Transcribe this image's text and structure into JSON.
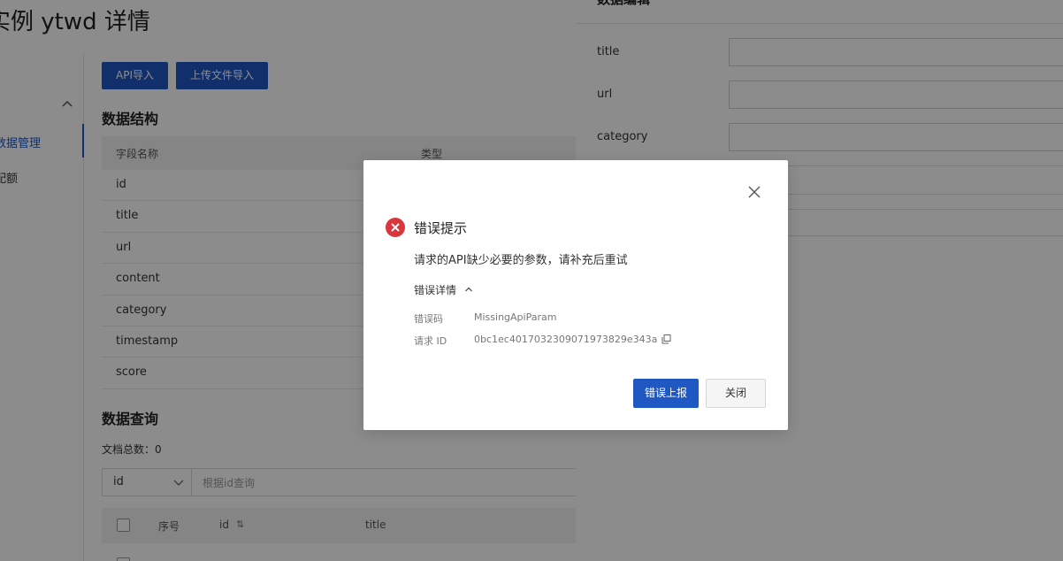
{
  "page": {
    "title": "实例 ytwd 详情",
    "sidebar": {
      "active_item": "数据管理",
      "item2": "配额"
    },
    "actions": {
      "api_import": "API导入",
      "upload_import": "上传文件导入"
    },
    "structure": {
      "title": "数据结构",
      "columns": [
        "字段名称",
        "类型"
      ],
      "fields": [
        "id",
        "title",
        "url",
        "content",
        "category",
        "timestamp",
        "score"
      ]
    },
    "query": {
      "title": "数据查询",
      "doc_count_label": "文档总数：0",
      "select_value": "id",
      "input_placeholder": "根据id查询",
      "table": {
        "col_seq": "序号",
        "col_id": "id",
        "col_id_sort": "⇅",
        "col_title": "title"
      }
    }
  },
  "drawer": {
    "title": "数据编辑",
    "fields": [
      "title",
      "url",
      "category"
    ]
  },
  "dialog": {
    "title": "错误提示",
    "message": "请求的API缺少必要的参数，请补充后重试",
    "detail_toggle": "错误详情",
    "error_code_label": "错误码",
    "error_code_value": "MissingApiParam",
    "request_id_label": "请求 ID",
    "request_id_value": "0bc1ec4017032309071973829e343a",
    "report_button": "错误上报",
    "close_button": "关闭"
  },
  "colors": {
    "primary": "#1f57c3",
    "error": "#d9363e",
    "overlay": "rgba(0,0,0,0.45)"
  },
  "icons": [
    "chevron-up-icon",
    "chevron-down-icon",
    "sort-icon",
    "close-icon",
    "error-icon",
    "copy-icon"
  ]
}
